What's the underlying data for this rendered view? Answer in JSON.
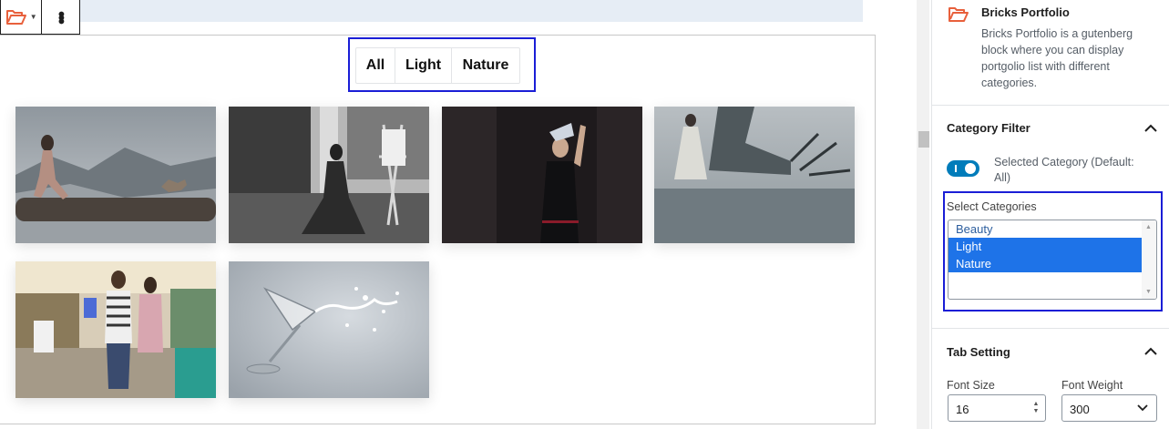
{
  "editor": {
    "filter_tabs": [
      "All",
      "Light",
      "Nature"
    ],
    "gallery": [
      {
        "name": "woman-on-log-with-cat"
      },
      {
        "name": "woman-painting-easel"
      },
      {
        "name": "woman-dark-dress-arm-raised"
      },
      {
        "name": "bride-tree-lake"
      },
      {
        "name": "shopping-women-mall"
      },
      {
        "name": "martini-glass-splash"
      }
    ]
  },
  "sidebar": {
    "block": {
      "title": "Bricks Portfolio",
      "description": "Bricks Portfolio is a gutenberg block where you can display portgolio list with different categories.",
      "icon": "folder-open-icon",
      "icon_color": "#e8603c"
    },
    "category_filter": {
      "title": "Category Filter",
      "toggle_label": "Selected Category (Default: All)",
      "toggle_on": true,
      "select_label": "Select Categories",
      "options": [
        {
          "label": "Beauty",
          "selected": false
        },
        {
          "label": "Light",
          "selected": true
        },
        {
          "label": "Nature",
          "selected": true
        }
      ]
    },
    "tab_setting": {
      "title": "Tab Setting",
      "font_size_label": "Font Size",
      "font_size_value": "16",
      "font_weight_label": "Font Weight",
      "font_weight_value": "300"
    }
  },
  "colors": {
    "accent": "#007cba",
    "highlight_border": "#1a1ed6",
    "selected_option": "#1e73e8"
  }
}
